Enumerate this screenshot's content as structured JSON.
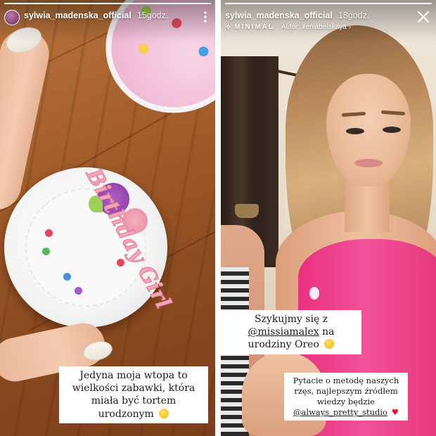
{
  "left_story": {
    "username": "sylwia_madenska_official",
    "time": "15godz.",
    "progress": 1.0,
    "plush_text": "Birthday Girl",
    "caption": "Jedyna moja wtopa to wielkości zabawki, która miała być tortem urodzonym"
  },
  "right_story": {
    "username": "sylwia_madenska_official",
    "time": "18godz.",
    "progress": 1.0,
    "filter_name": "MINIMAL",
    "author": "Autor: xeniabelskaya",
    "author_chevron": "›",
    "caption_1_prefix": "Szykujmy się z",
    "caption_1_mention": "@missiamalex",
    "caption_1_suffix": "na urodziny Oreo",
    "caption_2_text": "Pytacie o metodę naszych rzęs, najlepszym źródłem wiedzy będzie",
    "caption_2_mention": "@always_pretty_studio"
  },
  "icons": {
    "close": "close-icon",
    "more": "more-icon",
    "heart": "heart-icon",
    "emoji": "emoji-icon",
    "sparkle": "sparkle-icon"
  },
  "colors": {
    "top_pink": "#ea2f7e",
    "caption_bg": "#ffffff",
    "heart": "#e0142b"
  }
}
